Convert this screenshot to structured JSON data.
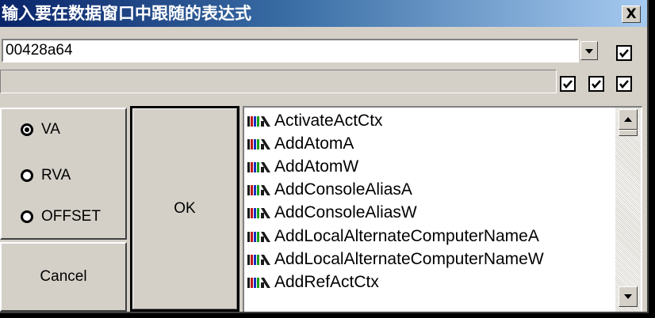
{
  "window": {
    "title": "输入要在数据窗口中跟随的表达式",
    "close_label": "X"
  },
  "expression": {
    "value": "00428a64"
  },
  "address_mode": {
    "options": [
      "VA",
      "RVA",
      "OFFSET"
    ],
    "selected": "VA"
  },
  "buttons": {
    "ok_label": "OK",
    "cancel_label": "Cancel"
  },
  "checkboxes": {
    "history": true,
    "option_1": true,
    "option_2": true,
    "option_3": true
  },
  "function_list": {
    "items": [
      "ActivateActCtx",
      "AddAtomA",
      "AddAtomW",
      "AddConsoleAliasA",
      "AddConsoleAliasW",
      "AddLocalAlternateComputerNameA",
      "AddLocalAlternateComputerNameW",
      "AddRefActCtx"
    ],
    "item_icon": "function-icon"
  },
  "colors": {
    "titlebar_start": "#0a246a",
    "titlebar_end": "#a6caf0",
    "dialog_face": "#d4d0c8"
  }
}
